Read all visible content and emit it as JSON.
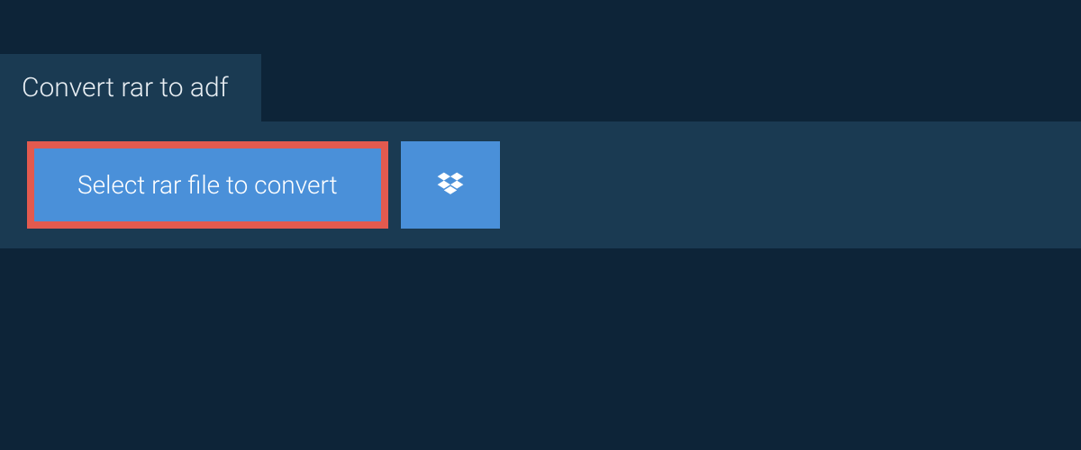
{
  "header": {
    "tab_label": "Convert rar to adf"
  },
  "actions": {
    "select_file_label": "Select rar file to convert"
  },
  "colors": {
    "page_bg": "#0d2438",
    "panel_bg": "#1a3a52",
    "button_bg": "#4a90d9",
    "highlight_border": "#e35a4f",
    "text_light": "#e8eef3",
    "text_white": "#ffffff"
  },
  "icons": {
    "dropbox": "dropbox-icon"
  }
}
